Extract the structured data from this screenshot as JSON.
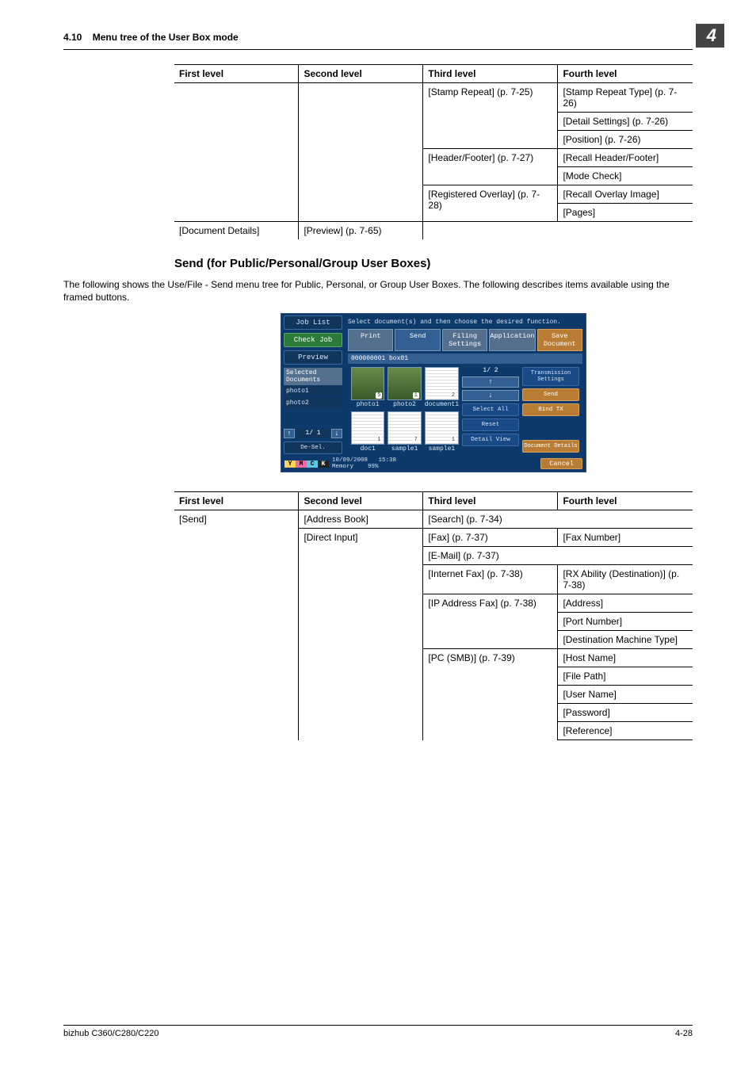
{
  "header": {
    "section_no": "4.10",
    "section_title": "Menu tree of the User Box mode",
    "chapter": "4"
  },
  "table1": {
    "head": {
      "c1": "First level",
      "c2": "Second level",
      "c3": "Third level",
      "c4": "Fourth level"
    },
    "r1c3": "[Stamp Repeat] (p. 7-25)",
    "r1c4": "[Stamp Repeat Type] (p. 7-26)",
    "r2c4": "[Detail Settings] (p. 7-26)",
    "r3c4": "[Position] (p. 7-26)",
    "r4c3": "[Header/Footer] (p. 7-27)",
    "r4c4": "[Recall Header/Footer]",
    "r5c4": "[Mode Check]",
    "r6c3": "[Registered Overlay] (p. 7-28)",
    "r6c4": "[Recall Overlay Image]",
    "r7c4": "[Pages]",
    "r8c1": "[Document Details]",
    "r8c2": "[Preview] (p. 7-65)"
  },
  "section2": {
    "title": "Send (for Public/Personal/Group User Boxes)",
    "para": "The following shows the Use/File - Send menu tree for Public, Personal, or Group User Boxes. The following describes items available using the framed buttons."
  },
  "panel": {
    "job_list": "Job List",
    "check_job": "Check Job",
    "preview": "Preview",
    "instr": "Select document(s) and then choose the desired function.",
    "tabs": {
      "print": "Print",
      "send": "Send",
      "filing": "Filing Settings",
      "application": "Application",
      "save": "Save Document"
    },
    "boxbar": "000000001   box01",
    "sel_head": "Selected Documents",
    "sel1": "photo1",
    "sel2": "photo2",
    "thumbs": [
      "photo1",
      "photo2",
      "document1",
      "doc1",
      "sample1",
      "sample1"
    ],
    "thumb_badges": [
      "5",
      "1",
      "2",
      "1",
      "7",
      "1"
    ],
    "right": {
      "trans": "Transmission Settings",
      "send": "Send",
      "bind": "Bind TX",
      "selectall": "Select All",
      "reset": "Reset",
      "detail": "Detail View",
      "docdet": "Document Details",
      "cancel": "Cancel",
      "pager": "1/ 2"
    },
    "pager_left": "1/  1",
    "del": "De-Sel.",
    "status": {
      "date": "10/09/2008",
      "time": "15:38",
      "mem": "Memory",
      "mempct": "99%"
    }
  },
  "table2": {
    "head": {
      "c1": "First level",
      "c2": "Second level",
      "c3": "Third level",
      "c4": "Fourth level"
    },
    "r1c1": "[Send]",
    "r1c2": "[Address Book]",
    "r1c3": "[Search] (p. 7-34)",
    "r2c2": "[Direct Input]",
    "r2c3": "[Fax] (p. 7-37)",
    "r2c4": "[Fax Number]",
    "r3c3": "[E-Mail] (p. 7-37)",
    "r4c3": "[Internet Fax] (p. 7-38)",
    "r4c4": "[RX Ability (Destination)] (p. 7-38)",
    "r5c3": "[IP Address Fax] (p. 7-38)",
    "r5c4": "[Address]",
    "r6c4": "[Port Number]",
    "r7c4": "[Destination Machine Type]",
    "r8c3": "[PC (SMB)] (p. 7-39)",
    "r8c4": "[Host Name]",
    "r9c4": "[File Path]",
    "r10c4": "[User Name]",
    "r11c4": "[Password]",
    "r12c4": "[Reference]"
  },
  "footer": {
    "left": "bizhub C360/C280/C220",
    "right": "4-28"
  },
  "chart_data": {
    "type": "table",
    "tables": [
      {
        "title": "Menu tree continuation (top table)",
        "columns": [
          "First level",
          "Second level",
          "Third level",
          "Fourth level"
        ],
        "rows": [
          [
            "",
            "",
            "[Stamp Repeat] (p. 7-25)",
            "[Stamp Repeat Type] (p. 7-26)"
          ],
          [
            "",
            "",
            "",
            "[Detail Settings] (p. 7-26)"
          ],
          [
            "",
            "",
            "",
            "[Position] (p. 7-26)"
          ],
          [
            "",
            "",
            "[Header/Footer] (p. 7-27)",
            "[Recall Header/Footer]"
          ],
          [
            "",
            "",
            "",
            "[Mode Check]"
          ],
          [
            "",
            "",
            "[Registered Overlay] (p. 7-28)",
            "[Recall Overlay Image]"
          ],
          [
            "",
            "",
            "",
            "[Pages]"
          ],
          [
            "[Document Details]",
            "[Preview] (p. 7-65)",
            "",
            ""
          ]
        ]
      },
      {
        "title": "Send menu tree (bottom table)",
        "columns": [
          "First level",
          "Second level",
          "Third level",
          "Fourth level"
        ],
        "rows": [
          [
            "[Send]",
            "[Address Book]",
            "[Search] (p. 7-34)",
            ""
          ],
          [
            "",
            "[Direct Input]",
            "[Fax] (p. 7-37)",
            "[Fax Number]"
          ],
          [
            "",
            "",
            "[E-Mail] (p. 7-37)",
            ""
          ],
          [
            "",
            "",
            "[Internet Fax] (p. 7-38)",
            "[RX Ability (Destination)] (p. 7-38)"
          ],
          [
            "",
            "",
            "[IP Address Fax] (p. 7-38)",
            "[Address]"
          ],
          [
            "",
            "",
            "",
            "[Port Number]"
          ],
          [
            "",
            "",
            "",
            "[Destination Machine Type]"
          ],
          [
            "",
            "",
            "[PC (SMB)] (p. 7-39)",
            "[Host Name]"
          ],
          [
            "",
            "",
            "",
            "[File Path]"
          ],
          [
            "",
            "",
            "",
            "[User Name]"
          ],
          [
            "",
            "",
            "",
            "[Password]"
          ],
          [
            "",
            "",
            "",
            "[Reference]"
          ]
        ]
      }
    ]
  }
}
